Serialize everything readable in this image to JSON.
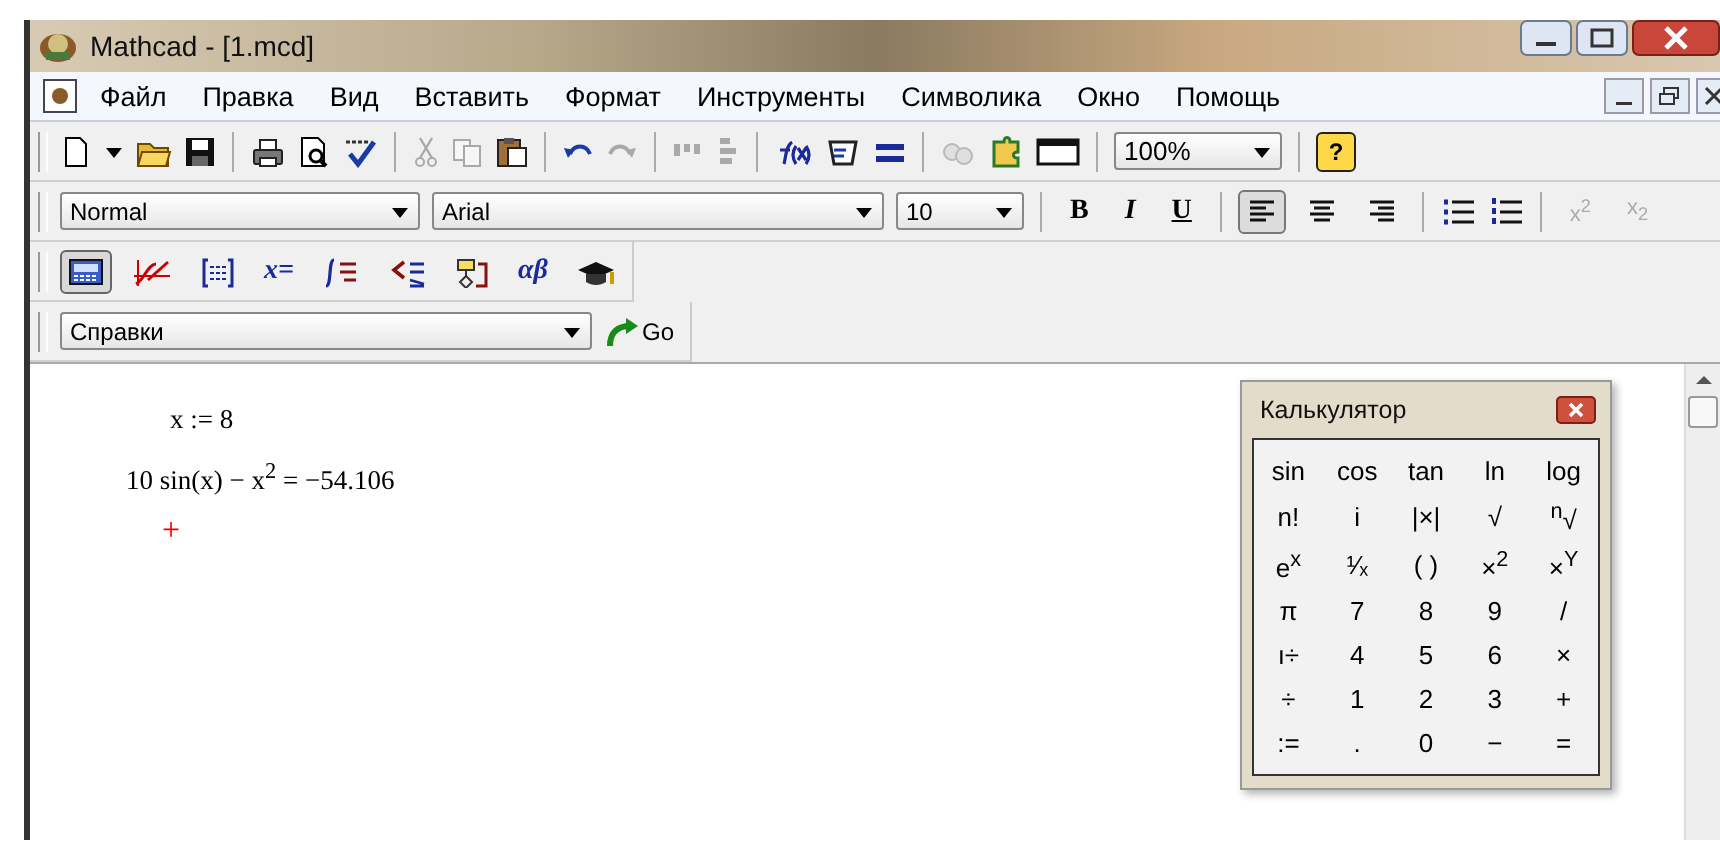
{
  "window": {
    "title": "Mathcad - [1.mcd]"
  },
  "menu": [
    {
      "label": "Файл"
    },
    {
      "label": "Правка"
    },
    {
      "label": "Вид"
    },
    {
      "label": "Вставить"
    },
    {
      "label": "Формат"
    },
    {
      "label": "Инструменты"
    },
    {
      "label": "Символика"
    },
    {
      "label": "Окно"
    },
    {
      "label": "Помощь"
    }
  ],
  "standard_toolbar": [
    {
      "kind": "new",
      "disabled": false
    },
    {
      "kind": "caret",
      "disabled": false
    },
    {
      "kind": "open",
      "disabled": false
    },
    {
      "kind": "save",
      "disabled": false
    },
    {
      "kind": "sep"
    },
    {
      "kind": "print",
      "disabled": false
    },
    {
      "kind": "preview",
      "disabled": false
    },
    {
      "kind": "spell",
      "disabled": false
    },
    {
      "kind": "sep"
    },
    {
      "kind": "cut",
      "disabled": true
    },
    {
      "kind": "copy",
      "disabled": true
    },
    {
      "kind": "paste",
      "disabled": false
    },
    {
      "kind": "sep"
    },
    {
      "kind": "undo",
      "disabled": false
    },
    {
      "kind": "redo",
      "disabled": true
    },
    {
      "kind": "sep"
    },
    {
      "kind": "align-across",
      "disabled": true
    },
    {
      "kind": "align-down",
      "disabled": true
    },
    {
      "kind": "sep"
    },
    {
      "kind": "function",
      "disabled": false
    },
    {
      "kind": "unit",
      "disabled": false
    },
    {
      "kind": "calculate",
      "disabled": false
    },
    {
      "kind": "sep"
    },
    {
      "kind": "component",
      "disabled": true
    },
    {
      "kind": "resource",
      "disabled": false
    },
    {
      "kind": "region",
      "disabled": false
    }
  ],
  "zoom": {
    "value": "100%"
  },
  "help_button": {
    "label": "?"
  },
  "format_toolbar": {
    "style": "Normal",
    "font": "Arial",
    "size": "10",
    "bold": {
      "label": "B"
    },
    "italic": {
      "label": "I"
    },
    "underline": {
      "label": "U"
    },
    "align": [
      {
        "selected": true
      },
      {
        "selected": false
      },
      {
        "selected": false
      }
    ],
    "superscript": {
      "label": "x$^{2}$",
      "disabled": true
    },
    "subscript": {
      "label": "x$_{2}$",
      "disabled": true
    }
  },
  "math_toolbar": [
    {
      "kind": "calculator",
      "selected": true
    },
    {
      "kind": "graph",
      "selected": false
    },
    {
      "kind": "matrix",
      "selected": false
    },
    {
      "kind": "text",
      "label": "x=",
      "selected": false
    },
    {
      "kind": "calculus",
      "selected": false
    },
    {
      "kind": "boolean",
      "selected": false
    },
    {
      "kind": "programming",
      "selected": false
    },
    {
      "kind": "text",
      "label": "αβ",
      "selected": false
    },
    {
      "kind": "symbolic",
      "selected": false
    }
  ],
  "resources": {
    "value": "Справки",
    "go": "Go"
  },
  "worksheet": {
    "lines": [
      {
        "text": "x := 8"
      },
      {
        "text": "10 sin(x) − x$^{2}$ = −54.106"
      }
    ],
    "cursor": "+"
  },
  "calculator": {
    "title": "Калькулятор",
    "keys": [
      [
        "sin",
        "cos",
        "tan",
        "ln",
        "log"
      ],
      [
        "n!",
        "i",
        "|×|",
        "√",
        "$^{n}$√"
      ],
      [
        "e$^{x}$",
        "¹⁄ₓ",
        "( )",
        "×$^{2}$",
        "×$^{Y}$"
      ],
      [
        "π",
        "7",
        "8",
        "9",
        "/"
      ],
      [
        "ı÷",
        "4",
        "5",
        "6",
        "×"
      ],
      [
        "÷",
        "1",
        "2",
        "3",
        "+"
      ],
      [
        ":=",
        ".",
        "0",
        "−",
        "="
      ]
    ]
  }
}
